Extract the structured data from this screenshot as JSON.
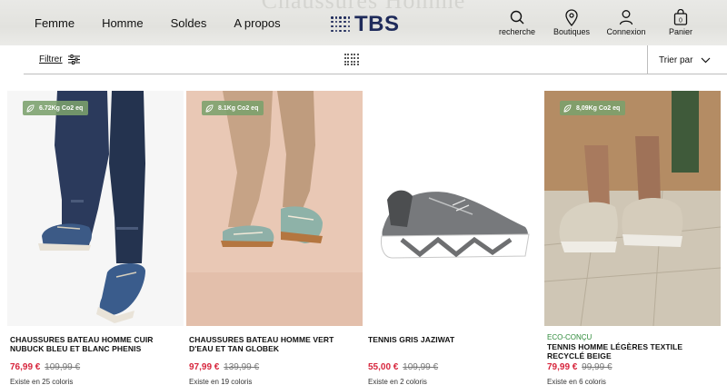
{
  "header": {
    "ghost_title": "Chaussures Homme",
    "nav": [
      {
        "label": "Femme"
      },
      {
        "label": "Homme"
      },
      {
        "label": "Soldes"
      },
      {
        "label": "A propos"
      }
    ],
    "logo_text": "TBS",
    "actions": [
      {
        "label": "recherche",
        "icon": "search-icon"
      },
      {
        "label": "Boutiques",
        "icon": "location-pin-icon"
      },
      {
        "label": "Connexion",
        "icon": "user-icon"
      },
      {
        "label": "Panier",
        "icon": "bag-icon",
        "count": "0"
      }
    ]
  },
  "toolbar": {
    "filter_label": "Filtrer",
    "sort_label": "Trier par"
  },
  "products": [
    {
      "badge": "6.72Kg Co2 eq",
      "eco_label": "",
      "title": "CHAUSSURES BATEAU HOMME CUIR NUBUCK BLEU ET BLANC PHENIS",
      "price": "76,99 €",
      "old_price": "109,99 €",
      "colors": "Existe en 25 coloris"
    },
    {
      "badge": "8.1Kg Co2 eq",
      "eco_label": "",
      "title": "CHAUSSURES BATEAU HOMME VERT D'EAU ET TAN GLOBEK",
      "price": "97,99 €",
      "old_price": "139,99 €",
      "colors": "Existe en 19 coloris"
    },
    {
      "badge": "",
      "eco_label": "",
      "title": "TENNIS GRIS JAZIWAT",
      "price": "55,00 €",
      "old_price": "109,99 €",
      "colors": "Existe en 2 coloris"
    },
    {
      "badge": "8,09Kg Co2 eq",
      "eco_label": "ECO-CONÇU",
      "title": "TENNIS HOMME LÉGÈRES TEXTILE RECYCLÉ BEIGE",
      "price": "79,99 €",
      "old_price": "99,99 €",
      "colors": "Existe en 6 coloris"
    }
  ],
  "colors": {
    "brand": "#1e2a5a",
    "price": "#d7263d",
    "eco": "#2e8b3a",
    "badge": "#7ba06c"
  }
}
